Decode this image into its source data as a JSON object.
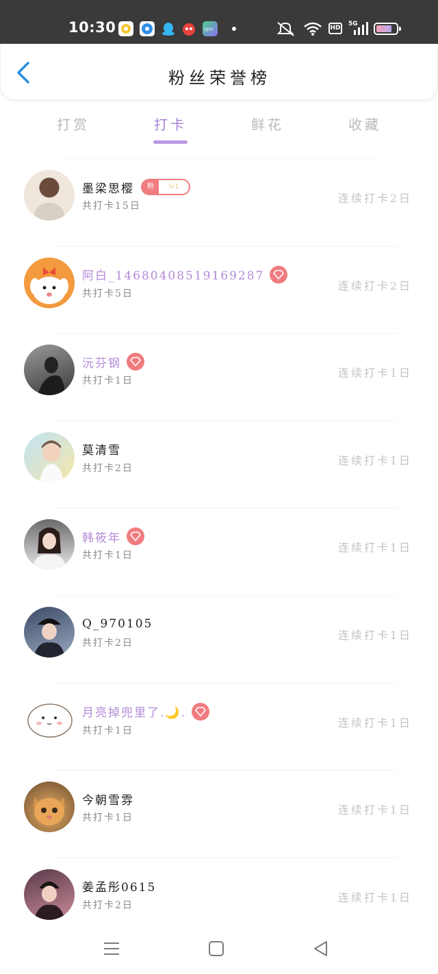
{
  "status_bar": {
    "time": "10:30",
    "network": "5G",
    "hd": "HD",
    "app_icons": [
      "app-icon-yellow",
      "app-icon-blue",
      "qq-icon",
      "app-icon-red",
      "iqiyi-icon"
    ]
  },
  "header": {
    "title": "粉丝荣誉榜",
    "back_icon": "chevron-left-icon"
  },
  "tabs": [
    {
      "label": "打赏"
    },
    {
      "label": "打卡"
    },
    {
      "label": "鲜花"
    },
    {
      "label": "收藏"
    }
  ],
  "active_tab": "打卡",
  "fan_badge": {
    "left": "粉",
    "right": "lv1"
  },
  "rows": [
    {
      "name": "墨梁思樱",
      "total": "共打卡15日",
      "streak": "连续打卡2日",
      "vip": false
    },
    {
      "name": "阿白_14680408519169287",
      "total": "共打卡5日",
      "streak": "连续打卡2日",
      "vip": true
    },
    {
      "name": "沅芬钢",
      "total": "共打卡1日",
      "streak": "连续打卡1日",
      "vip": true
    },
    {
      "name": "莫清雪",
      "total": "共打卡2日",
      "streak": "连续打卡1日",
      "vip": false
    },
    {
      "name": "韩筱年",
      "total": "共打卡1日",
      "streak": "连续打卡1日",
      "vip": true
    },
    {
      "name": "Q_970105",
      "total": "共打卡2日",
      "streak": "连续打卡1日",
      "vip": false
    },
    {
      "name": "月亮掉兜里了.🌙.",
      "total": "共打卡1日",
      "streak": "连续打卡1日",
      "vip": true
    },
    {
      "name": "今朝雪雰",
      "total": "共打卡1日",
      "streak": "连续打卡1日",
      "vip": false
    },
    {
      "name": "姜孟彤0615",
      "total": "共打卡2日",
      "streak": "连续打卡1日",
      "vip": false
    }
  ],
  "colors": {
    "accent": "#a482d8",
    "vip_name": "#b38ad8",
    "gem": "#f07c80",
    "status_bar": "#3a3a3a"
  }
}
